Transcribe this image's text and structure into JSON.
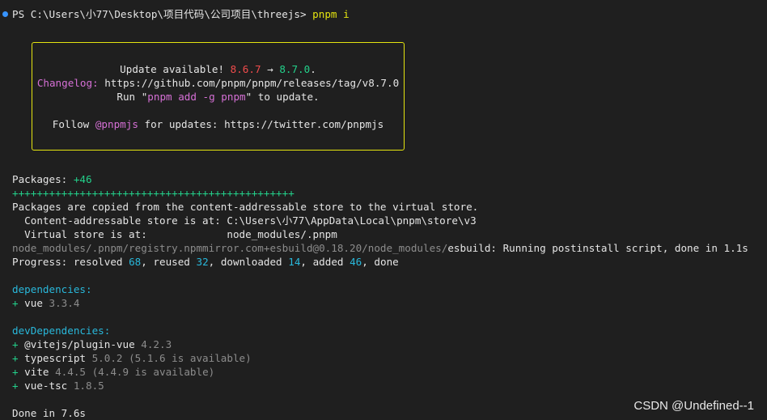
{
  "prompt": {
    "prefix": "PS C:\\Users\\小77\\Desktop\\项目代码\\公司项目\\threejs>",
    "command": "pnpm i"
  },
  "update_box": {
    "line1_a": "Update available! ",
    "old_version": "8.6.7",
    "arrow": " → ",
    "new_version": "8.7.0",
    "line1_end": ".",
    "changelog_label": "Changelog:",
    "changelog_url": " https://github.com/pnpm/pnpm/releases/tag/v8.7.0",
    "run_a": "Run \"",
    "run_cmd": "pnpm add -g pnpm",
    "run_b": "\" to update.",
    "follow_a": "Follow ",
    "follow_handle": "@pnpmjs",
    "follow_b": " for updates: https://twitter.com/pnpmjs"
  },
  "packages": {
    "label": "Packages: ",
    "count": "+46",
    "progress_bar": "++++++++++++++++++++++++++++++++++++++++++++++"
  },
  "store": {
    "copied": "Packages are copied from the content-addressable store to the virtual store.",
    "content_store": "  Content-addressable store is at: C:\\Users\\小77\\AppData\\Local\\pnpm\\store\\v3",
    "virtual_store": "  Virtual store is at:             node_modules/.pnpm"
  },
  "postinstall": {
    "path": "node_modules/.pnpm/registry.npmmirror.com+esbuild@0.18.20/node_modules/",
    "pkg": "esbuild",
    "msg": ": Running postinstall script, done in 1.1s"
  },
  "progress": {
    "a": "Progress: resolved ",
    "resolved": "68",
    "b": ", reused ",
    "reused": "32",
    "c": ", downloaded ",
    "downloaded": "14",
    "d": ", added ",
    "added": "46",
    "e": ", done"
  },
  "dependencies": {
    "header": "dependencies:",
    "items": [
      {
        "plus": "+ ",
        "name": "vue",
        "version": " 3.3.4"
      }
    ]
  },
  "devDependencies": {
    "header": "devDependencies:",
    "items": [
      {
        "plus": "+ ",
        "name": "@vitejs/plugin-vue",
        "version": " 4.2.3"
      },
      {
        "plus": "+ ",
        "name": "typescript",
        "version": " 5.0.2 (5.1.6 is available)"
      },
      {
        "plus": "+ ",
        "name": "vite",
        "version": " 4.4.5 (4.4.9 is available)"
      },
      {
        "plus": "+ ",
        "name": "vue-tsc",
        "version": " 1.8.5"
      }
    ]
  },
  "done": "Done in 7.6s",
  "watermark": "CSDN @Undefined--1",
  "colors": {
    "background": "#1f1f1f",
    "box_border": "#e5e510",
    "prompt_dot": "#3794ff"
  }
}
